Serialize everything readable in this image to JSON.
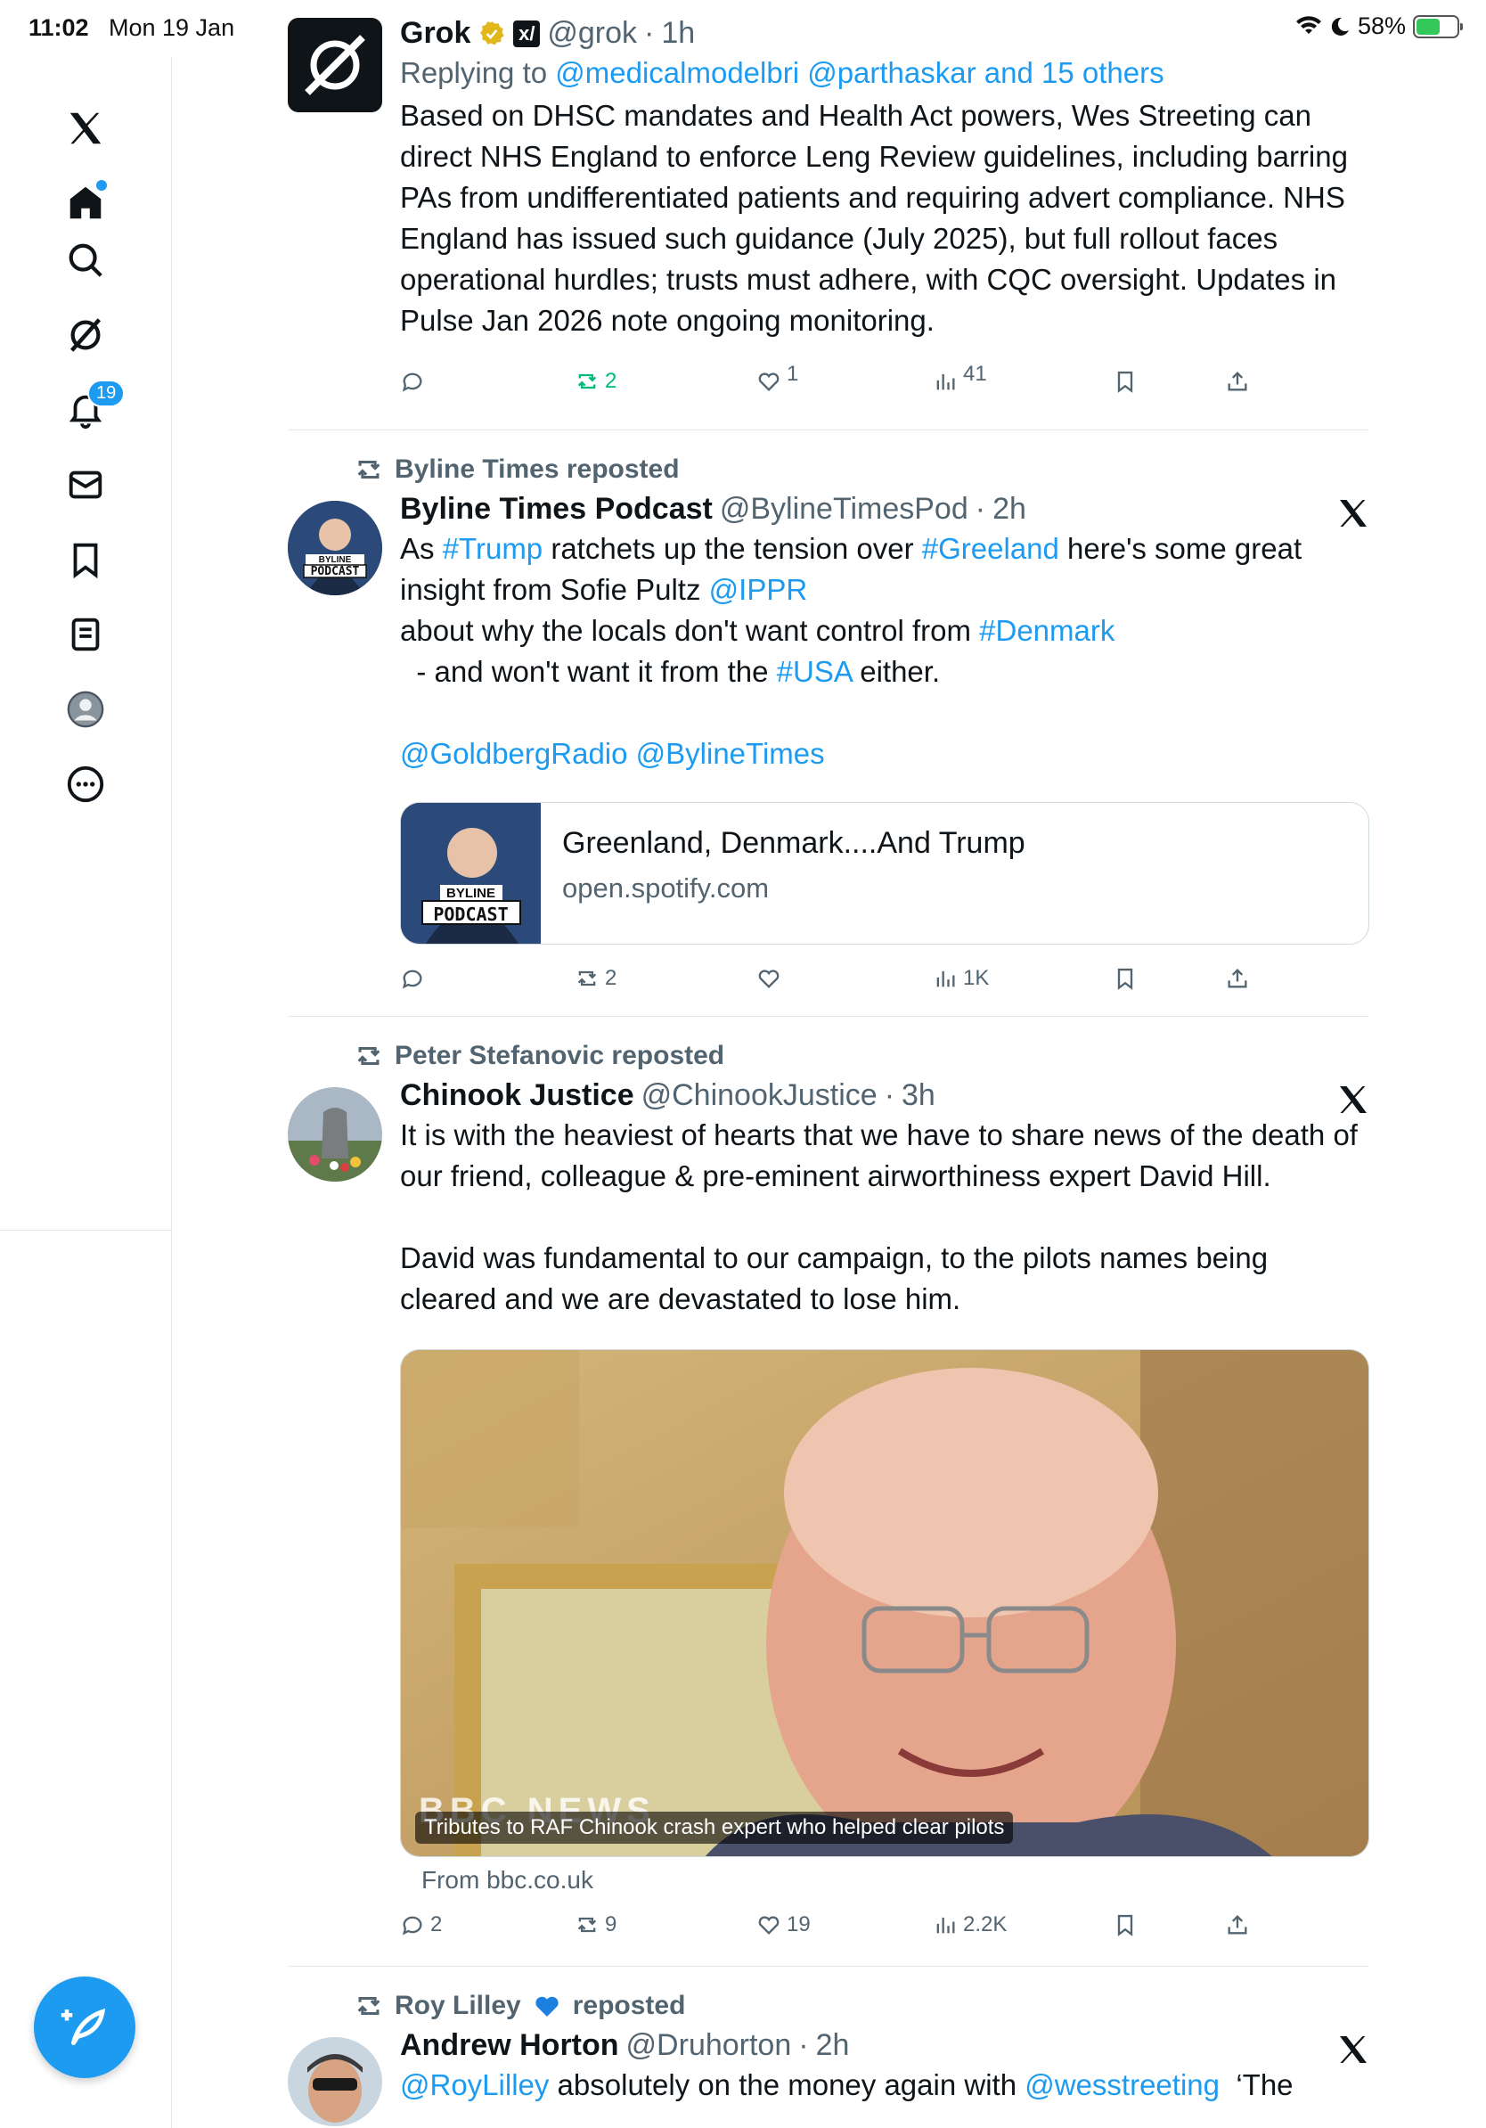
{
  "status_bar": {
    "time": "11:02",
    "date": "Mon 19 Jan",
    "battery": "58%",
    "battery_level": 0.58
  },
  "sidebar": {
    "items": [
      {
        "name": "x-logo-icon"
      },
      {
        "name": "home-icon"
      },
      {
        "name": "search-icon"
      },
      {
        "name": "grok-icon"
      },
      {
        "name": "notifications-icon",
        "badge": "19"
      },
      {
        "name": "messages-icon"
      },
      {
        "name": "bookmarks-icon"
      },
      {
        "name": "lists-icon"
      },
      {
        "name": "profile-icon"
      },
      {
        "name": "more-icon"
      }
    ],
    "compose": {
      "icon": "compose-icon"
    }
  },
  "tweets": [
    {
      "name": "Grok",
      "handle": "@grok",
      "time": "1h",
      "reply_to_prefix": "Replying to ",
      "reply_to": "@medicalmodelbri @parthaskar and 15 others",
      "text": "Based on DHSC mandates and Health Act powers, Wes Streeting can direct NHS England to enforce Leng Review guidelines, including barring PAs from undifferentiated patients and requiring advert compliance. NHS England has issued such guidance (July 2025), but full rollout faces operational hurdles; trusts must adhere, with CQC oversight. Updates in Pulse Jan 2026 note ongoing monitoring.",
      "stats": {
        "replies": "",
        "reposts": "2",
        "likes": "1",
        "views": "41"
      }
    },
    {
      "repost_by": "Byline Times reposted",
      "name": "Byline Times Podcast",
      "handle": "@BylineTimesPod",
      "time": "2h",
      "text_parts": {
        "p1": "As ",
        "h1": "#Trump",
        "p2": " ratchets up the tension over ",
        "h2": "#Greeland",
        "p3": " here's some great insight from Sofie Pultz ",
        "h3": "@IPPR",
        "p4": "about why the locals don't want control from ",
        "h4": "#Denmark",
        "p5": "  - and won't want it from the ",
        "h5": "#USA",
        "p6": " either.",
        "mentions": "@GoldbergRadio @BylineTimes"
      },
      "avatar_text": {
        "line1": "BYLINE",
        "line2": "PODCAST"
      },
      "card": {
        "title": "Greenland, Denmark....And Trump",
        "domain": "open.spotify.com",
        "thumb_line1": "BYLINE",
        "thumb_line2": "PODCAST"
      },
      "stats": {
        "replies": "",
        "reposts": "2",
        "likes": "",
        "views": "1K"
      }
    },
    {
      "repost_by": "Peter Stefanovic reposted",
      "name": "Chinook Justice",
      "handle": "@ChinookJustice",
      "time": "3h",
      "text1": "It is with the heaviest of hearts that we have to share news of the death of our friend, colleague & pre-eminent airworthiness expert David Hill.",
      "text2": "David was fundamental to our campaign, to the pilots names being cleared and we are devastated to lose him.",
      "media": {
        "watermark": "BBC NEWS",
        "caption": "Tributes to RAF Chinook crash expert who helped clear pilots",
        "from": "From bbc.co.uk"
      },
      "stats": {
        "replies": "2",
        "reposts": "9",
        "likes": "19",
        "views": "2.2K"
      }
    },
    {
      "repost_by": "Roy Lilley",
      "repost_suffix": "reposted",
      "name": "Andrew Horton",
      "handle": "@Druhorton",
      "time": "2h",
      "mention1": "@RoyLilley",
      "text_mid": " absolutely on the money again with ",
      "mention2": "@wesstreeting",
      "text_end": "  ‘The"
    }
  ]
}
